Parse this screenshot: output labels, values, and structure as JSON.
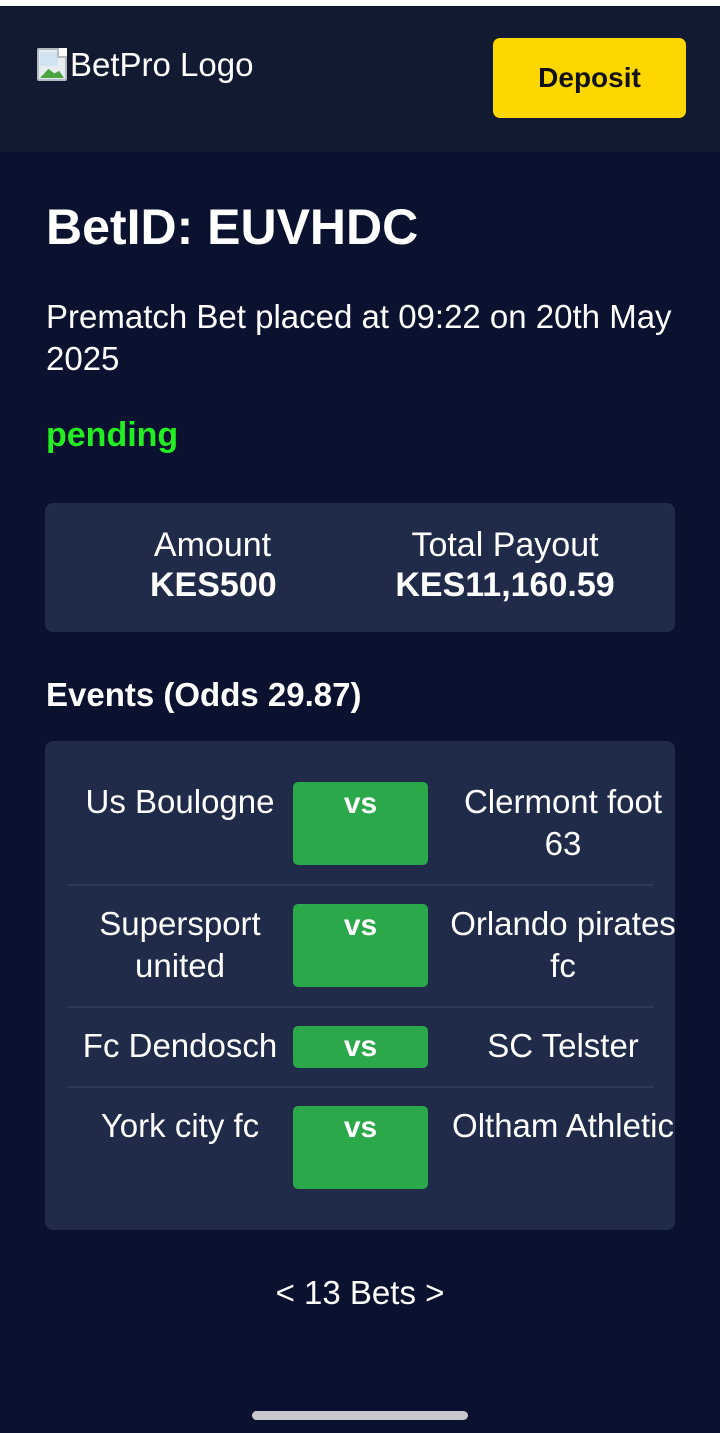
{
  "header": {
    "logo_text": "BetPro Logo",
    "deposit_label": "Deposit"
  },
  "bet": {
    "title": "BetID: EUVHDC",
    "placed_info": "Prematch Bet placed at 09:22 on 20th May 2025",
    "status": "pending",
    "status_color": "#22ee22"
  },
  "summary": {
    "amount_label": "Amount",
    "amount_value": "KES500",
    "payout_label": "Total Payout",
    "payout_value": "KES11,160.59"
  },
  "events": {
    "heading": "Events (Odds 29.87)",
    "vs_label": "vs",
    "items": [
      {
        "home": "Us Boulogne",
        "away": "Clermont foot 63"
      },
      {
        "home": "Supersport united",
        "away": "Orlando pirates fc"
      },
      {
        "home": "Fc Dendosch",
        "away": "SC Telster"
      },
      {
        "home": "York city fc",
        "away": "Oltham Athletic"
      }
    ]
  },
  "pager": {
    "prev": "<",
    "label": "13 Bets",
    "next": ">"
  },
  "colors": {
    "background": "#0b1230",
    "card": "#1f2b48",
    "accent": "#ffd700",
    "vs_badge": "#2aa84a"
  }
}
